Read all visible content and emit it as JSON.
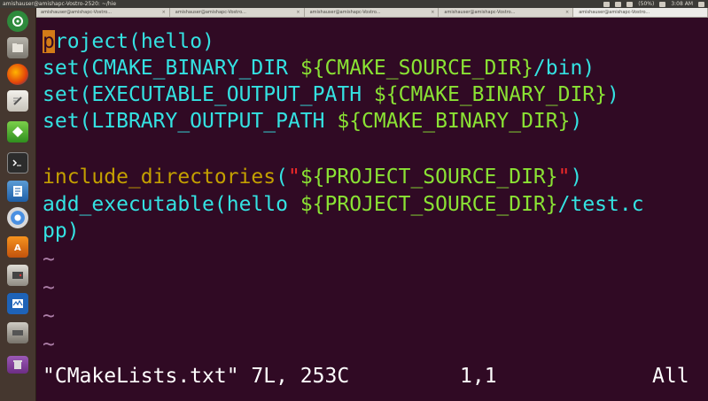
{
  "window": {
    "title": "amishauser@amishapc-Vostro-2520: ~/hie",
    "tray": {
      "battery": "(50%)",
      "time": "3:08 AM"
    }
  },
  "tabs": [
    {
      "label": "amishauser@amishapc-Vostro...",
      "close": "×"
    },
    {
      "label": "amishauser@amishapc-Vostro...",
      "close": "×"
    },
    {
      "label": "amishauser@amishapc-Vostro...",
      "close": "×"
    },
    {
      "label": "amishauser@amishapc-Vostro...",
      "close": "×"
    },
    {
      "label": "amishauser@amishapc-Vostro...",
      "close": ""
    }
  ],
  "launcher": {
    "items": [
      {
        "name": "dash-home-icon"
      },
      {
        "name": "files-icon"
      },
      {
        "name": "firefox-icon"
      },
      {
        "name": "text-editor-icon"
      },
      {
        "name": "gem-icon"
      },
      {
        "name": "terminal-icon"
      },
      {
        "name": "document-viewer-icon"
      },
      {
        "name": "chromium-icon"
      },
      {
        "name": "software-center-icon"
      },
      {
        "name": "disk-icon"
      },
      {
        "name": "system-monitor-icon"
      },
      {
        "name": "drive-icon"
      },
      {
        "name": "trash-icon"
      }
    ]
  },
  "editor": {
    "lines": [
      {
        "fn": "project",
        "cursor_char": "p",
        "rest": "roject",
        "open": "(",
        "arg": "hello",
        "close": ")"
      },
      {
        "fn": "set",
        "open": "(",
        "arg": "CMAKE_BINARY_DIR ",
        "var": "${CMAKE_SOURCE_DIR}",
        "tail": "/bin",
        "close": ")"
      },
      {
        "fn": "set",
        "open": "(",
        "arg": "EXECUTABLE_OUTPUT_PATH ",
        "var": "${CMAKE_BINARY_DIR}",
        "close": ")"
      },
      {
        "fn": "set",
        "open": "(",
        "arg": "LIBRARY_OUTPUT_PATH ",
        "var": "${CMAKE_BINARY_DIR}",
        "close": ")"
      },
      {
        "fn": "include_directories",
        "open": "(",
        "quote1": "\"",
        "var": "${PROJECT_SOURCE_DIR}",
        "quote2": "\"",
        "close": ")"
      },
      {
        "fn": "add_executable",
        "open": "(",
        "arg": "hello ",
        "var": "${PROJECT_SOURCE_DIR}",
        "tail": "/test.c"
      },
      {
        "wrap": "pp)"
      }
    ],
    "tildes": [
      "~",
      "~",
      "~",
      "~"
    ],
    "status": {
      "file": "\"CMakeLists.txt\" 7L, 253C",
      "position": "1,1",
      "scroll": "All"
    }
  }
}
